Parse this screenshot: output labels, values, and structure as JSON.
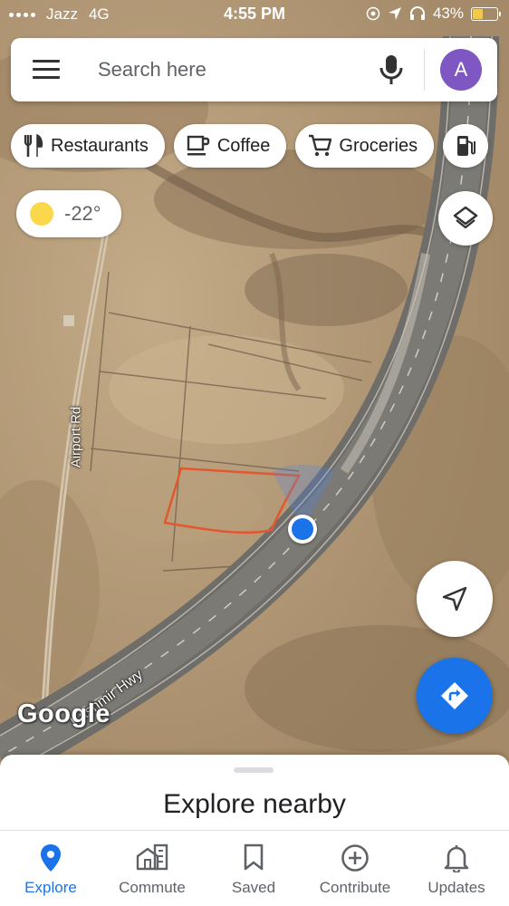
{
  "status_bar": {
    "carrier": "Jazz",
    "network": "4G",
    "time": "4:55 PM",
    "battery_percent": "43%",
    "battery_level": 0.43,
    "battery_color": "#f2c94c"
  },
  "search": {
    "placeholder": "Search here",
    "account_initial": "A",
    "avatar_color": "#7e57c2"
  },
  "chips": [
    {
      "label": "Restaurants",
      "icon": "restaurant-icon"
    },
    {
      "label": "Coffee",
      "icon": "coffee-icon"
    },
    {
      "label": "Groceries",
      "icon": "cart-icon"
    },
    {
      "label": "",
      "icon": "gas-station-icon"
    }
  ],
  "weather": {
    "temperature": "-22°",
    "icon": "sun-icon"
  },
  "map": {
    "provider_logo": "Google",
    "road_labels": {
      "airport_rd": "Airport Rd",
      "kashmir_hwy": "Kashmir Hwy"
    },
    "map_type": "satellite",
    "accent_color": "#1a73e8",
    "outline_color": "#e4572e"
  },
  "buttons": {
    "layers_icon": "layers-icon",
    "locate_icon": "navigation-arrow-icon",
    "directions_icon": "directions-icon"
  },
  "sheet": {
    "title": "Explore nearby"
  },
  "nav": {
    "active": "Explore",
    "items": [
      {
        "label": "Explore",
        "icon": "location-pin-icon"
      },
      {
        "label": "Commute",
        "icon": "commute-icon"
      },
      {
        "label": "Saved",
        "icon": "bookmark-icon"
      },
      {
        "label": "Contribute",
        "icon": "add-circle-icon"
      },
      {
        "label": "Updates",
        "icon": "bell-icon"
      }
    ]
  }
}
